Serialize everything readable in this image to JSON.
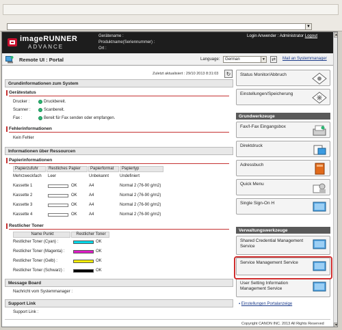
{
  "browser": {
    "drop_arrow": "▼"
  },
  "header": {
    "brand_line1": "imageRUNNER",
    "brand_line2": "ADVANCE",
    "device_name_label": "Gerätename :",
    "product_name_label": "Produktname(Seriennummer) :",
    "location_label": "Ort :",
    "login_user": "Login Anwender : Administrator",
    "logout_label": "Logout"
  },
  "titlebar": {
    "title": "Remote UI : Portal",
    "language_label": "Language:",
    "language_value": "German",
    "mail_link": "Mail an Systemmanager"
  },
  "main": {
    "updated": "Zuletzt aktualisiert : 29/10 2013 8:31:03",
    "system_section": "Grundinformationen zum System",
    "device_status_heading": "Gerätestatus",
    "device_status": [
      {
        "label": "Drucker :",
        "value": "Druckbereit."
      },
      {
        "label": "Scanner :",
        "value": "Scanbereit."
      },
      {
        "label": "Fax :",
        "value": "Bereit für Fax senden oder empfangen."
      }
    ],
    "error_heading": "Fehlerinformationen",
    "error_value": "Kein Fehler",
    "resources_section": "Informationen über Ressourcen",
    "paper_heading": "Papierinformationen",
    "paper_columns": [
      "Papierzufuhr",
      "Restliches Papier",
      "Papierformat",
      "Papiertyp"
    ],
    "paper_rows": [
      {
        "source": "Mehrzweckfach",
        "remaining": "Leer",
        "format": "Unbekannt",
        "type": "Undefiniert"
      },
      {
        "source": "Kassette 1",
        "remaining": "OK",
        "format": "A4",
        "type": "Normal 2 (76-90 g/m2)"
      },
      {
        "source": "Kassette 2",
        "remaining": "OK",
        "format": "A4",
        "type": "Normal 2 (76-90 g/m2)"
      },
      {
        "source": "Kassette 3",
        "remaining": "OK",
        "format": "A4",
        "type": "Normal 2 (76-90 g/m2)"
      },
      {
        "source": "Kassette 4",
        "remaining": "OK",
        "format": "A4",
        "type": "Normal 2 (76-90 g/m2)"
      }
    ],
    "toner_heading": "Restlicher Toner",
    "toner_columns": [
      "Name Punkt",
      "Restlicher Toner"
    ],
    "toner_rows": [
      {
        "name": "Restlicher Toner (Cyan) :",
        "status": "OK",
        "color": "#00d8e8"
      },
      {
        "name": "Restlicher Toner (Magenta) :",
        "status": "OK",
        "color": "#e01bc8"
      },
      {
        "name": "Restlicher Toner (Gelb) :",
        "status": "OK",
        "color": "#f5ec00"
      },
      {
        "name": "Restlicher Toner (Schwarz) :",
        "status": "OK",
        "color": "#000000"
      }
    ],
    "message_section": "Message Board",
    "message_text": "Nachricht vom Systemmanager :",
    "support_section": "Support Link",
    "support_text": "Support Link :"
  },
  "side": {
    "status_monitor": "Status Monitor/Abbruch",
    "settings": "Einstellungen/Speicherung",
    "basic_tools": "Grundwerkzeuge",
    "fax_inbox": "Fax/I-Fax Eingangsbox",
    "direct_print": "Direktdruck",
    "address_book": "Adressbuch",
    "quick_menu": "Quick Menu",
    "single_sign_on": "Single Sign-On H",
    "admin_tools": "Verwaltungswerkzeuge",
    "shared_credential": "Shared Credential Management Service",
    "service_management": "Service Management Service",
    "user_setting": "User Setting Information Management Service",
    "portal_settings": "Einstellungen Portalanzeige"
  },
  "footer": {
    "copyright": "Copyright CANON INC. 2013 All Rights Reserved"
  },
  "colors": {
    "accent_red": "#d02e2e",
    "header_bg": "#1d1d1d",
    "status_green": "#2bb673"
  }
}
